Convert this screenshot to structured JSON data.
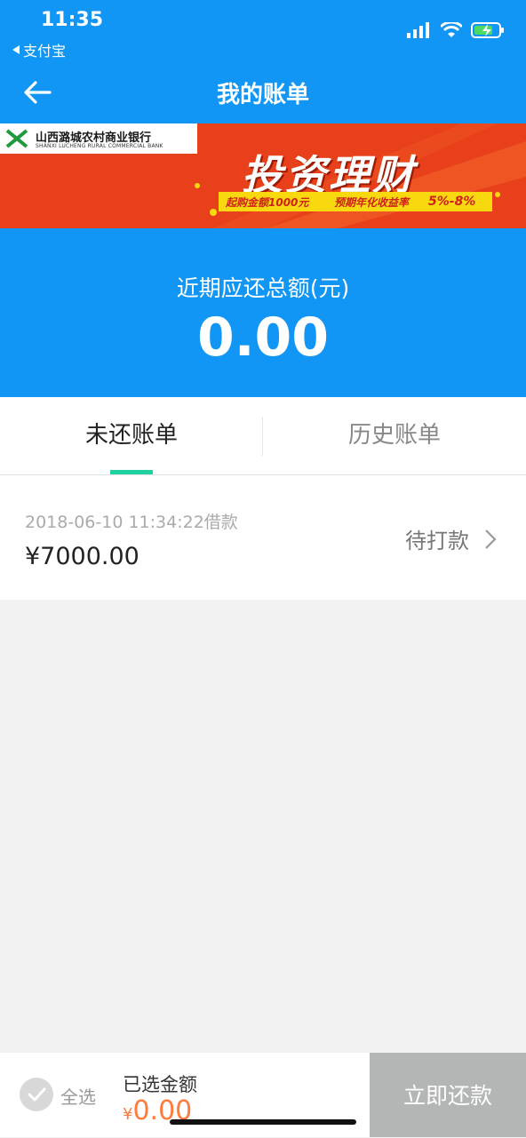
{
  "status_bar": {
    "time": "11:35",
    "back_app_label": "支付宝"
  },
  "nav": {
    "title": "我的账单",
    "back_icon": "arrow-left-icon"
  },
  "banner": {
    "bank_name_cn": "山西潞城农村商业银行",
    "bank_name_en": "SHANXI LUCHENG RURAL COMMERCIAL BANK",
    "slogan": "投资理财",
    "min_purchase": "起购金额1000元",
    "yield_label": "预期年化收益率",
    "yield_range": "5%-8%"
  },
  "summary": {
    "label": "近期应还总额(元)",
    "amount": "0.00"
  },
  "tabs": [
    {
      "label": "未还账单",
      "active": true
    },
    {
      "label": "历史账单",
      "active": false
    }
  ],
  "bills": [
    {
      "datetime": "2018-06-10 11:34:22借款",
      "amount": "¥7000.00",
      "status": "待打款"
    }
  ],
  "footer": {
    "select_all": "全选",
    "selected_label": "已选金额",
    "currency": "¥",
    "selected_amount": "0.00",
    "repay_button": "立即还款"
  },
  "colors": {
    "header_blue": "#1296f5",
    "tab_indicator": "#1fd1a1",
    "amount_orange": "#ff7a3c",
    "button_gray": "#b4b6b6"
  }
}
